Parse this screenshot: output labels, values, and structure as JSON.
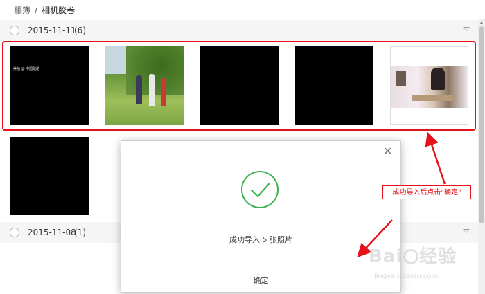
{
  "breadcrumb": {
    "parent": "相簿",
    "separator": "/",
    "current": "相机胶卷"
  },
  "groups": [
    {
      "date": "2015-11-11",
      "count": "(6)"
    },
    {
      "date": "2015-11-08",
      "count": "(1)"
    }
  ],
  "thumbs": [
    {
      "kind": "black",
      "watermark": "美拍 @ 中国最酷"
    },
    {
      "kind": "outdoor-photo"
    },
    {
      "kind": "black"
    },
    {
      "kind": "black"
    },
    {
      "kind": "indoor-photo"
    },
    {
      "kind": "black"
    }
  ],
  "dialog": {
    "message": "成功导入 5 张照片",
    "confirm_label": "确定",
    "close_icon": "close-icon",
    "success_icon": "check-circle-icon"
  },
  "annotation": {
    "text": "成功导入后点击\"确定\""
  },
  "watermark": {
    "brand": "Bai du 经验",
    "site": "jingyan.baidu.com"
  },
  "colors": {
    "highlight": "#e6121a",
    "success": "#3bb152",
    "group_bar": "#f5f5f5"
  }
}
